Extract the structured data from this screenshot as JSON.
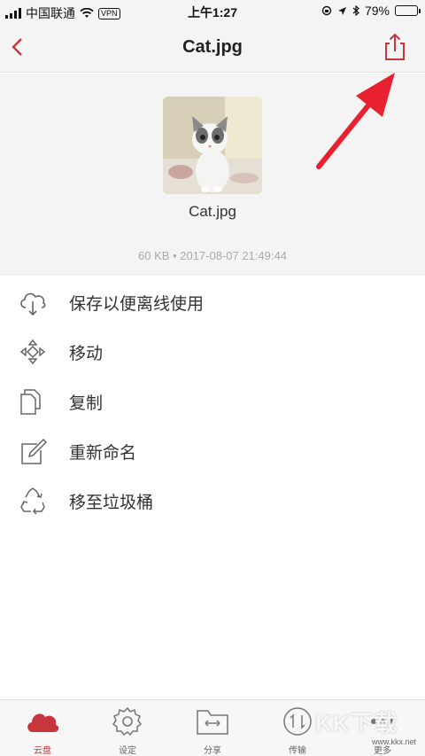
{
  "status_bar": {
    "carrier": "中国联通",
    "vpn": "VPN",
    "time": "上午1:27",
    "battery": "79%",
    "battery_level": 0.79
  },
  "nav": {
    "title": "Cat.jpg"
  },
  "file": {
    "name": "Cat.jpg",
    "meta": "60 KB • 2017-08-07 21:49:44"
  },
  "actions": [
    {
      "label": "保存以便离线使用",
      "icon": "cloud-download-icon"
    },
    {
      "label": "移动",
      "icon": "move-arrows-icon"
    },
    {
      "label": "复制",
      "icon": "copy-icon"
    },
    {
      "label": "重新命名",
      "icon": "rename-edit-icon"
    },
    {
      "label": "移至垃圾桶",
      "icon": "recycle-icon"
    }
  ],
  "tabs": [
    {
      "label": "云盘",
      "icon": "cloud-icon",
      "active": true
    },
    {
      "label": "设定",
      "icon": "gear-icon",
      "active": false
    },
    {
      "label": "分享",
      "icon": "share-folder-icon",
      "active": false
    },
    {
      "label": "传输",
      "icon": "transfer-icon",
      "active": false
    },
    {
      "label": "更多",
      "icon": "more-icon",
      "active": false
    }
  ],
  "watermark": {
    "logo": "KK下载",
    "url": "www.kkx.net"
  },
  "colors": {
    "accent": "#c8363d",
    "annotation_arrow": "#e8202f"
  }
}
